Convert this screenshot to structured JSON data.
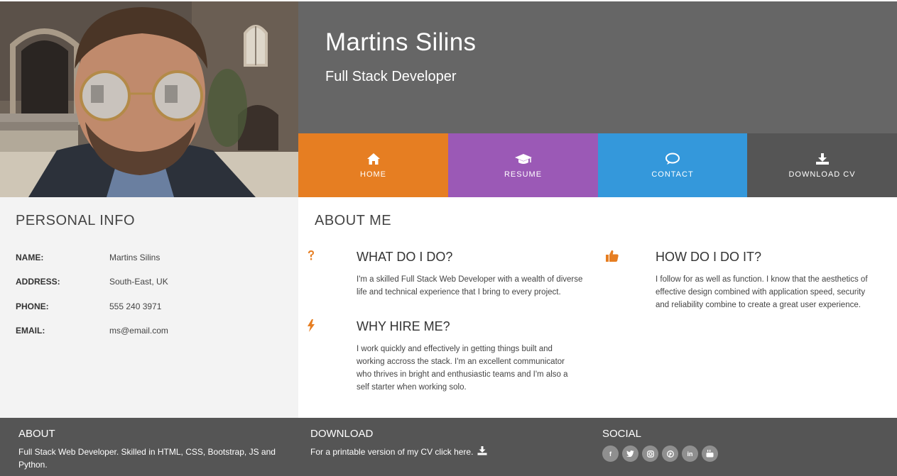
{
  "header": {
    "name": "Martins Silins",
    "role": "Full Stack Developer"
  },
  "nav": {
    "home": "HOME",
    "resume": "RESUME",
    "contact": "CONTACT",
    "download": "DOWNLOAD CV",
    "icons": [
      "home-icon",
      "graduation-cap-icon",
      "chat-bubble-icon",
      "download-icon"
    ]
  },
  "personal": {
    "title": "PERSONAL INFO",
    "rows": [
      {
        "key": "NAME:",
        "value": "Martins Silins"
      },
      {
        "key": "ADDRESS:",
        "value": "South-East, UK"
      },
      {
        "key": "PHONE:",
        "value": "555 240 3971"
      },
      {
        "key": "EMAIL:",
        "value": "ms@email.com"
      }
    ]
  },
  "about": {
    "title": "ABOUT ME",
    "what": {
      "title": "WHAT DO I DO?",
      "lines": [
        "I'm a skilled Full Stack Web Developer with a wealth of diverse",
        "life and technical experience that I bring to every project."
      ]
    },
    "how": {
      "title": "HOW DO I DO IT?",
      "lines": [
        "I follow for as well as function. I know that the aesthetics of",
        "effective design combined with application speed, security",
        "and reliability combine to create a great user experience."
      ]
    },
    "why": {
      "title": "WHY HIRE ME?",
      "lines": [
        "I work quickly and effectively in getting things built and",
        "working accross the stack. I'm an excellent communicator",
        "who thrives in bright and enthusiastic teams and I'm also a",
        "self starter when working solo."
      ]
    }
  },
  "footer": {
    "about_title": "ABOUT",
    "about_lines": [
      "Full Stack Web Developer. Skilled in HTML, CSS, Bootstrap, JS and",
      "Python."
    ],
    "download_title": "DOWNLOAD",
    "download_text": "For a printable version of my CV click here.",
    "social_title": "SOCIAL",
    "social_icons": [
      "facebook-icon",
      "twitter-icon",
      "instagram-icon",
      "pinterest-icon",
      "linkedin-icon",
      "youtube-icon"
    ]
  },
  "colors": {
    "header_bg": "#666666",
    "home": "#e67e22",
    "resume": "#9b59b6",
    "contact": "#3498db",
    "download": "#555555",
    "accent": "#e67e22",
    "footer_bg": "#555555"
  }
}
